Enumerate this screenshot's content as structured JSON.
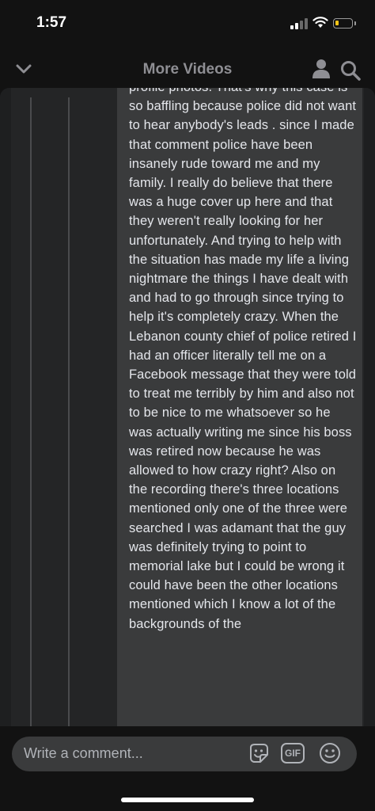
{
  "status_bar": {
    "time": "1:57",
    "icons": [
      "signal-icon",
      "wifi-icon",
      "battery-icon"
    ]
  },
  "header": {
    "title": "More Videos",
    "icons": [
      "chevron-down-icon",
      "profile-icon",
      "search-icon"
    ]
  },
  "comment": {
    "text": "profile photos. That's why this case is so baffling because police did not want to hear anybody's leads . since I made that comment police have been insanely rude toward me and my family. I really do believe that there was a huge cover up here and that they weren't really looking for her unfortunately. And trying to help with the situation has made my life a living nightmare the things I have dealt with and had to go through since trying to help it's completely crazy. When the Lebanon county chief of police retired I had an officer literally tell me on a Facebook message that they were told to treat me terribly by him and also not to be nice to me whatsoever so he was actually writing me since his boss was retired now because he was allowed to how crazy right? Also on the recording there's three locations mentioned only one of the three were searched I was adamant that the guy was definitely trying to point to memorial lake but I could be wrong it could have been the other locations mentioned which I know a lot of the backgrounds of the"
  },
  "composer": {
    "placeholder": "Write a comment...",
    "gif_label": "GIF",
    "icons": [
      "sticker-icon",
      "gif-icon",
      "emoji-icon"
    ]
  },
  "colors": {
    "background": "#121212",
    "panel": "#242526",
    "bubble": "#3a3b3c",
    "text": "#e4e6eb",
    "muted": "#b0b3b8"
  }
}
